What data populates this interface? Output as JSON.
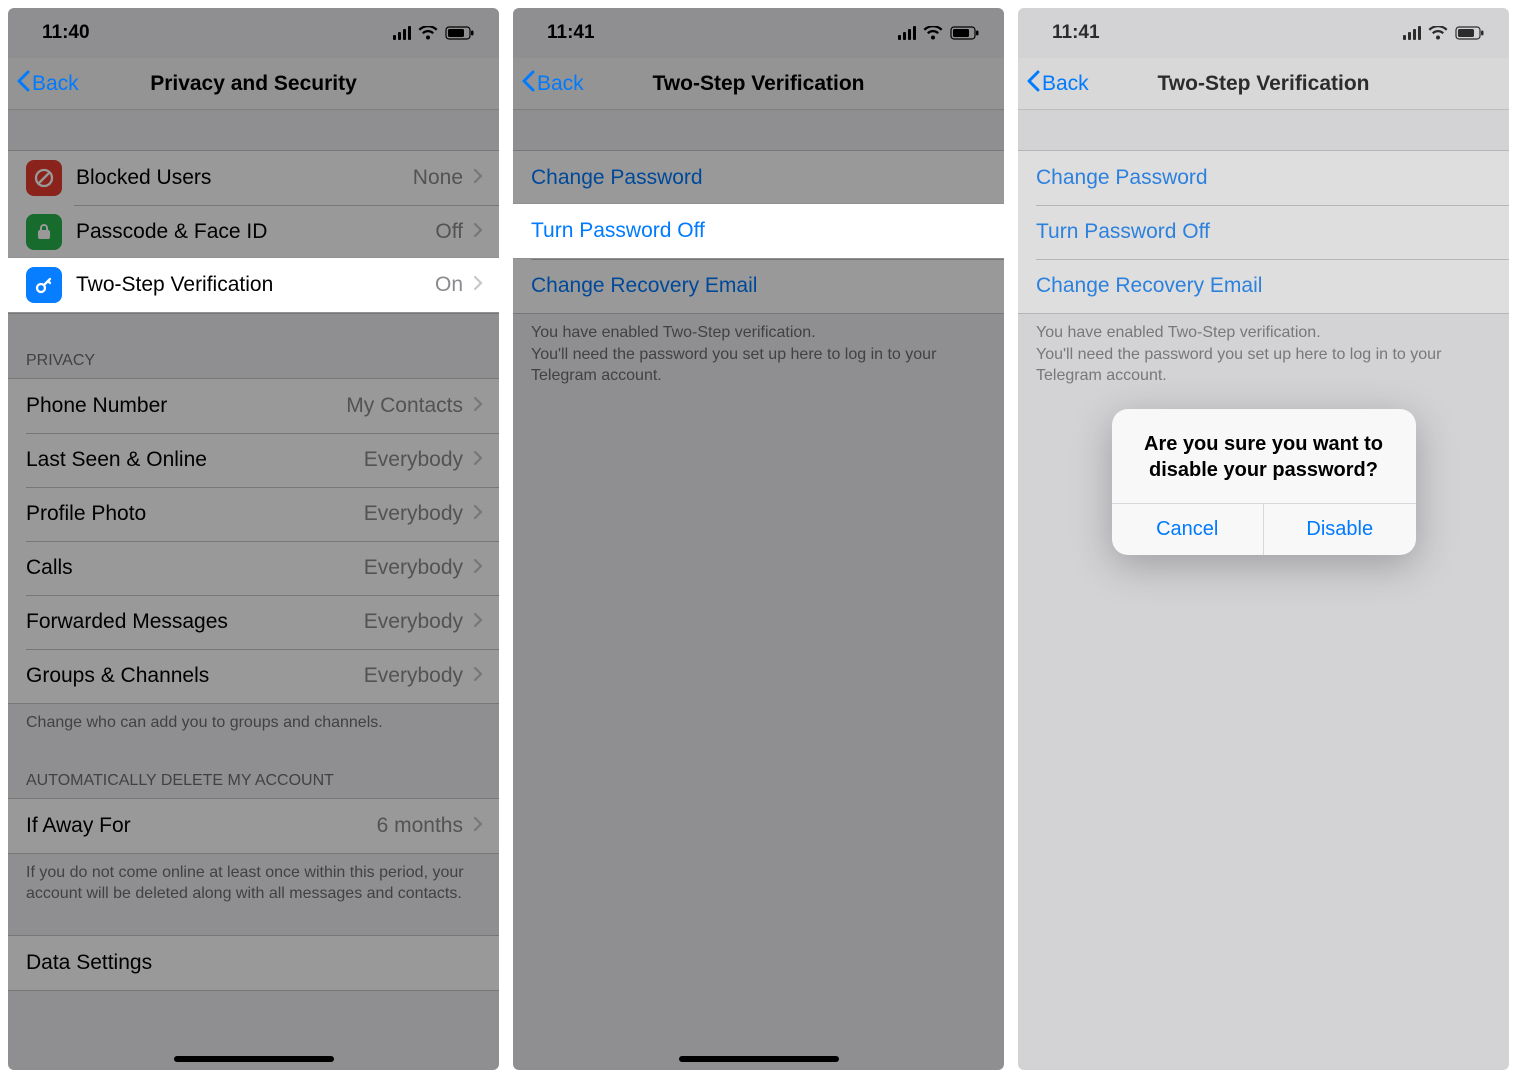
{
  "screen1": {
    "time": "11:40",
    "back": "Back",
    "title": "Privacy and Security",
    "security_items": [
      {
        "label": "Blocked Users",
        "value": "None"
      },
      {
        "label": "Passcode & Face ID",
        "value": "Off"
      },
      {
        "label": "Two-Step Verification",
        "value": "On"
      }
    ],
    "privacy_header": "PRIVACY",
    "privacy_items": [
      {
        "label": "Phone Number",
        "value": "My Contacts"
      },
      {
        "label": "Last Seen & Online",
        "value": "Everybody"
      },
      {
        "label": "Profile Photo",
        "value": "Everybody"
      },
      {
        "label": "Calls",
        "value": "Everybody"
      },
      {
        "label": "Forwarded Messages",
        "value": "Everybody"
      },
      {
        "label": "Groups & Channels",
        "value": "Everybody"
      }
    ],
    "privacy_footer": "Change who can add you to groups and channels.",
    "auto_delete_header": "AUTOMATICALLY DELETE MY ACCOUNT",
    "auto_delete_item": {
      "label": "If Away For",
      "value": "6 months"
    },
    "auto_delete_footer": "If you do not come online at least once within this period, your account will be deleted along with all messages and contacts.",
    "data_settings_label": "Data Settings"
  },
  "screen2": {
    "time": "11:41",
    "back": "Back",
    "title": "Two-Step Verification",
    "items": [
      "Change Password",
      "Turn Password Off",
      "Change Recovery Email"
    ],
    "footer": "You have enabled Two-Step verification.\nYou'll need the password you set up here to log in to your Telegram account."
  },
  "screen3": {
    "time": "11:41",
    "back": "Back",
    "title": "Two-Step Verification",
    "items": [
      "Change Password",
      "Turn Password Off",
      "Change Recovery Email"
    ],
    "footer": "You have enabled Two-Step verification.\nYou'll need the password you set up here to log in to your Telegram account.",
    "alert_title": "Are you sure you want to disable your password?",
    "alert_cancel": "Cancel",
    "alert_confirm": "Disable"
  }
}
